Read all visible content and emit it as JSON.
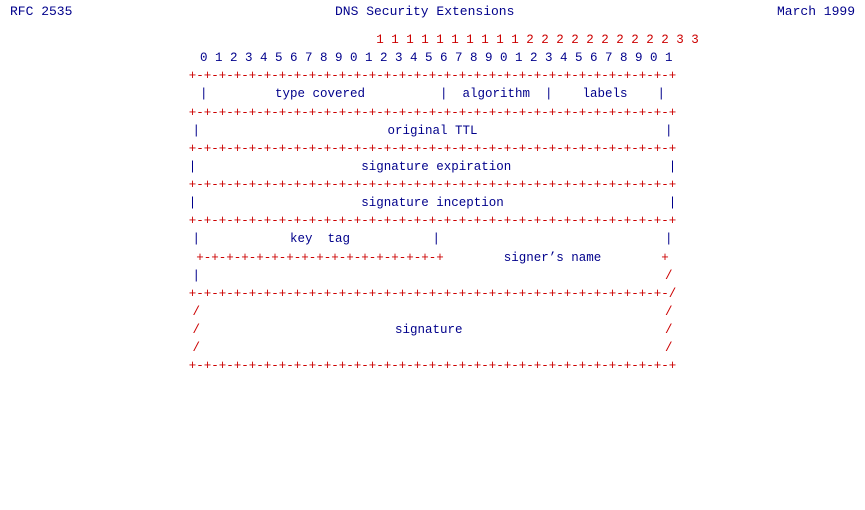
{
  "header": {
    "left": "RFC 2535",
    "center": "DNS Security Extensions",
    "right": "March 1999"
  },
  "diagram": {
    "bit_row_top": "                            1 1 1 1 1 1 1 1 1 1 2 2 2 2 2 2 2 2 2 2 3 3",
    "bit_row_nums": " 0 1 2 3 4 5 6 7 8 9 0 1 2 3 4 5 6 7 8 9 0 1 2 3 4 5 6 7 8 9 0 1",
    "divider": "+-+-+-+-+-+-+-+-+-+-+-+-+-+-+-+-+-+-+-+-+-+-+-+-+-+-+-+-+-+-+-+-+",
    "rows": [
      {
        "type": "field",
        "content": "|         type covered          |  algorithm  |    labels    |"
      },
      {
        "type": "divider"
      },
      {
        "type": "field",
        "content": "|                         original TTL                        |"
      },
      {
        "type": "divider"
      },
      {
        "type": "field",
        "content": "|                      signature expiration                    |"
      },
      {
        "type": "divider"
      },
      {
        "type": "field",
        "content": "|                      signature inception                     |"
      },
      {
        "type": "divider"
      },
      {
        "type": "field",
        "content": "|            key  tag           |                              |"
      },
      {
        "type": "divider_partial",
        "content": "+-+-+-+-+-+-+-+-+-+-+-+-+-+-+-+-+        signer's name        +"
      },
      {
        "type": "field2",
        "content": "|                                                              /"
      },
      {
        "type": "divider_slash",
        "content": "+-+-+-+-+-+-+-+-+-+-+-+-+-+-+-+-+-+-+-+-+-+-+-+-+-+-+-+-+-+-+-+-/"
      },
      {
        "type": "slash_field",
        "content": "/                                                              /"
      },
      {
        "type": "slash_field2",
        "content": "/                          signature                           /"
      },
      {
        "type": "slash_field",
        "content": "/                                                              /"
      },
      {
        "type": "divider"
      }
    ]
  }
}
